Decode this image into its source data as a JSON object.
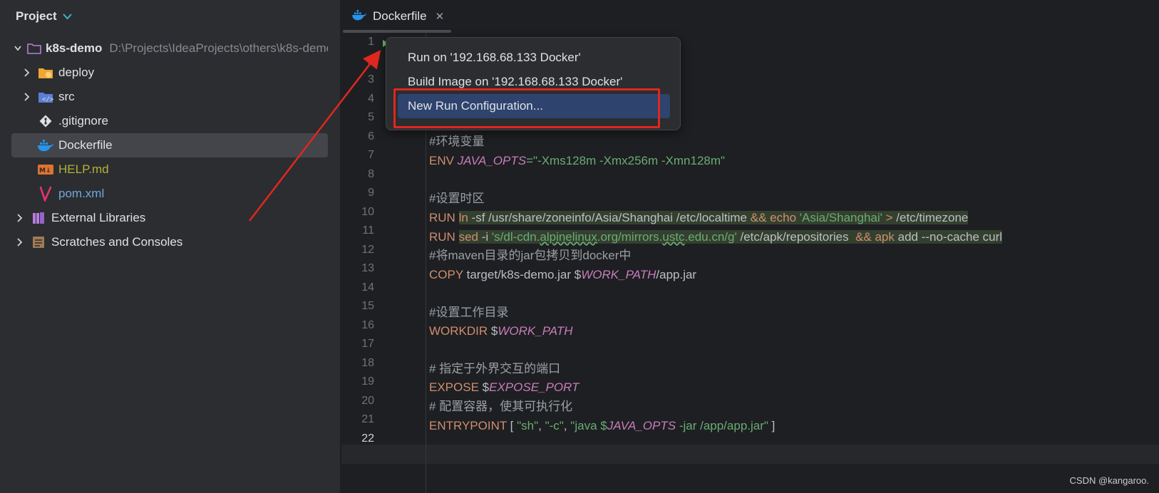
{
  "sidebar": {
    "title": "Project",
    "tree": [
      {
        "label": "k8s-demo",
        "path": "D:\\Projects\\IdeaProjects\\others\\k8s-demo",
        "expanded": true
      },
      {
        "label": "deploy"
      },
      {
        "label": "src"
      },
      {
        "label": ".gitignore"
      },
      {
        "label": "Dockerfile",
        "selected": true
      },
      {
        "label": "HELP.md"
      },
      {
        "label": "pom.xml"
      },
      {
        "label": "External Libraries"
      },
      {
        "label": "Scratches and Consoles"
      }
    ]
  },
  "editor": {
    "tab_label": "Dockerfile",
    "line_numbers": [
      "1",
      "2",
      "3",
      "4",
      "5",
      "6",
      "7",
      "8",
      "9",
      "10",
      "11",
      "12",
      "13",
      "14",
      "15",
      "16",
      "17",
      "18",
      "19",
      "20",
      "21",
      "22"
    ],
    "current_line": "22",
    "lines": {
      "l6": "#环境变量",
      "l7_kw": "ENV",
      "l7_var": "JAVA_OPTS",
      "l7_str": "=\"-Xms128m -Xmx256m -Xmn128m\"",
      "l9": "#设置时区",
      "l10_kw": "RUN",
      "l10_cmd1": "ln",
      "l10_a": " -sf /usr/share/zoneinfo/Asia/Shanghai /etc/localtime ",
      "l10_and": "&&",
      "l10_cmd2": " echo",
      "l10_str": " 'Asia/Shanghai'",
      "l10_redir": " >",
      "l10_b": " /etc/timezone",
      "l11_kw": "RUN",
      "l11_cmd1": "sed",
      "l11_a": " -i ",
      "l11_str1": "'s/dl-cdn.",
      "l11_str2": "alpinelinux",
      "l11_str3": ".org/mirrors.",
      "l11_str4": "ustc",
      "l11_str5": ".edu.cn/g'",
      "l11_b": " /etc/apk/repositories  ",
      "l11_and": "&&",
      "l11_cmd2": " apk",
      "l11_c": " add --no-cache curl",
      "l12": "#将maven目录的jar包拷贝到docker中",
      "l13_kw": "COPY",
      "l13_a": " target/k8s-demo.jar $",
      "l13_var": "WORK_PATH",
      "l13_b": "/app.jar",
      "l15": "#设置工作目录",
      "l16_kw": "WORKDIR",
      "l16_a": " $",
      "l16_var": "WORK_PATH",
      "l18": "# 指定于外界交互的端口",
      "l19_kw": "EXPOSE",
      "l19_a": " $",
      "l19_var": "EXPOSE_PORT",
      "l20": "# 配置容器，使其可执行化",
      "l21_kw": "ENTRYPOINT",
      "l21_a": " [ ",
      "l21_s1": "\"sh\"",
      "l21_c1": ", ",
      "l21_s2": "\"-c\"",
      "l21_c2": ", ",
      "l21_s3a": "\"java $",
      "l21_var": "JAVA_OPTS",
      "l21_s3b": " -jar /app/app.jar\"",
      "l21_end": " ]"
    }
  },
  "popup": {
    "items": [
      {
        "label": "Run on '192.168.68.133 Docker'"
      },
      {
        "label": "Build Image on '192.168.68.133 Docker'"
      },
      {
        "label": "New Run Configuration...",
        "selected": true
      }
    ]
  },
  "watermark": "CSDN @kangaroo.",
  "colors": {
    "accent_red": "#e0271f",
    "selection_blue": "#2e436e"
  }
}
